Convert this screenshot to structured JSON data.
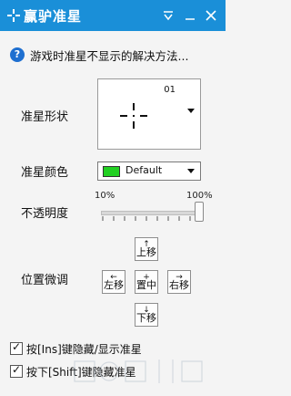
{
  "window": {
    "title": "赢驴准星",
    "accent": "#1a8fd8",
    "controls": [
      "dropdown-icon",
      "minimize-icon",
      "close-icon"
    ]
  },
  "help": {
    "text": "游戏时准星不显示的解决方法..."
  },
  "shape": {
    "label": "准星形状",
    "number": "01"
  },
  "color": {
    "label": "准星颜色",
    "value": "Default",
    "swatch": "#22d022"
  },
  "opacity": {
    "label": "不透明度",
    "min_label": "10%",
    "max_label": "100%",
    "value_percent": 100
  },
  "position": {
    "label": "位置微调",
    "up": {
      "arrow": "↑",
      "label": "上移"
    },
    "left": {
      "arrow": "←",
      "label": "左移"
    },
    "center": {
      "arrow": "+",
      "label": "置中"
    },
    "right": {
      "arrow": "→",
      "label": "右移"
    },
    "down": {
      "arrow": "↓",
      "label": "下移"
    }
  },
  "options": [
    {
      "label": "按[Ins]键隐藏/显示准星",
      "checked": true
    },
    {
      "label": "按下[Shift]键隐藏准星",
      "checked": true
    }
  ]
}
